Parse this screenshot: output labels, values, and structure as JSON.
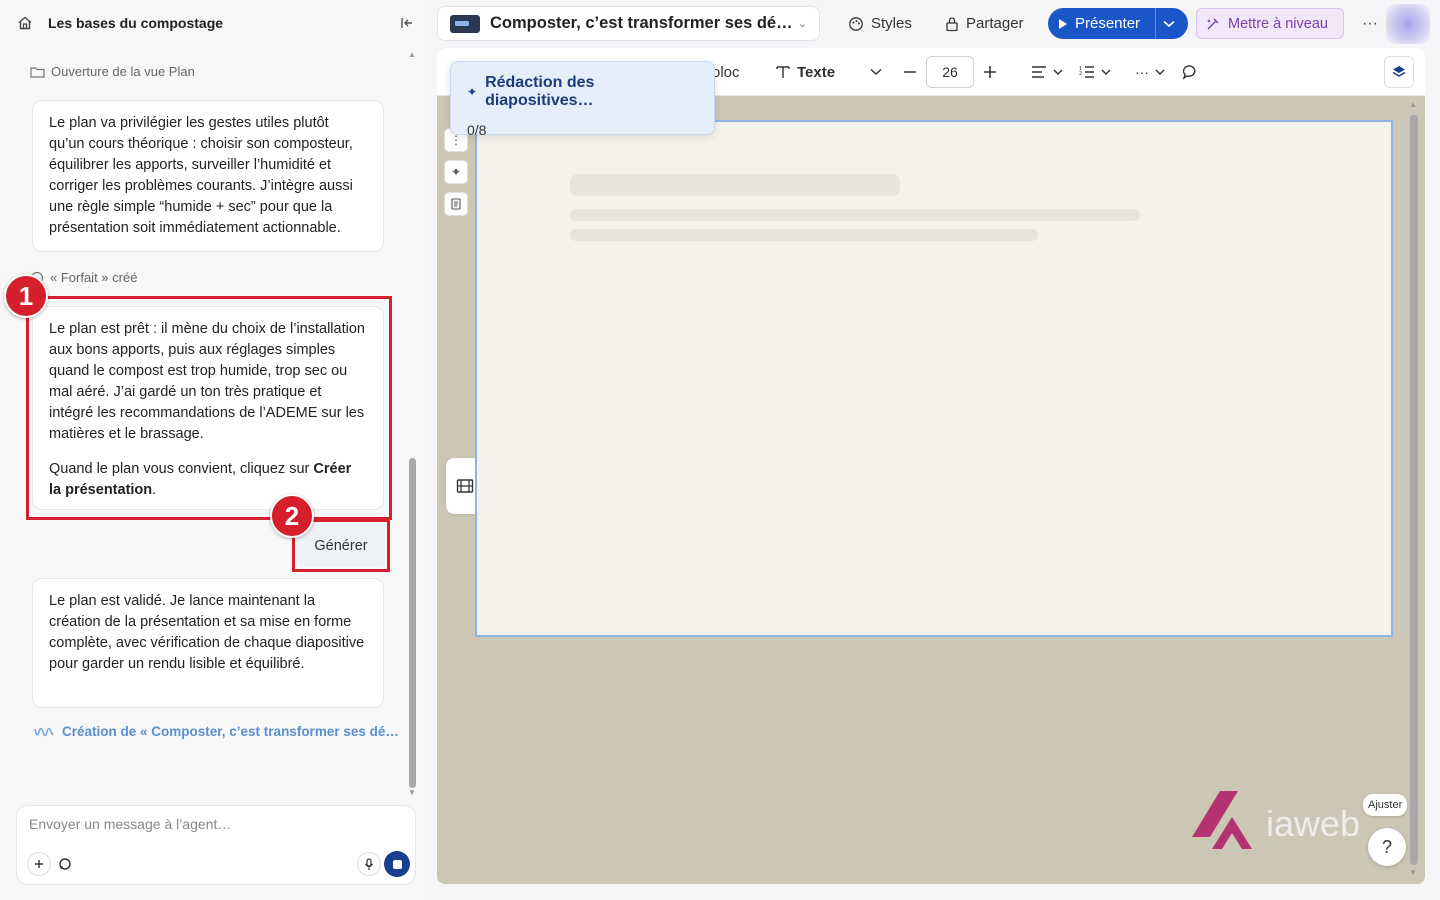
{
  "sidebar": {
    "title": "Les bases du compostage",
    "steps": {
      "plan_view": "Ouverture de la vue Plan",
      "forfait": "« Forfait » créé"
    },
    "messages": {
      "m1": "Le plan va privilégier les gestes utiles plutôt qu’un cours théorique : choisir son composteur, équilibrer les apports, surveiller l’humidité et corriger les problèmes courants. J’intègre aussi une règle simple “humide + sec” pour que la présentation soit immédiatement actionnable.",
      "m2_p1": "Le plan est prêt : il mène du choix de l’installation aux bons apports, puis aux réglages simples quand le compost est trop humide, trop sec ou mal aéré. J’ai gardé un ton très pratique et intégré les recommandations de l’ADEME sur les matières et le brassage.",
      "m2_p2_prefix": "Quand le plan vous convient, cliquez sur ",
      "m2_p2_bold": "Créer la présentation",
      "m2_p2_suffix": ".",
      "m3": "Le plan est validé. Je lance maintenant la création de la présentation et sa mise en forme complète, avec vérification de chaque diapositive pour garder un rendu lisible et équilibré."
    },
    "generate_label": "Générer",
    "creation_status": "Création de « Composter, c’est transformer ses dé…",
    "composer_placeholder": "Envoyer un message à l’agent…"
  },
  "annotations": {
    "badge1": "1",
    "badge2": "2",
    "color": "#d61f2c"
  },
  "topbar": {
    "deck_title": "Composter, c’est transformer ses dé…",
    "styles": "Styles",
    "share": "Partager",
    "present": "Présenter",
    "upgrade": "Mettre à niveau"
  },
  "toolbar": {
    "block_partial": "oloc",
    "text_label": "Texte",
    "font_size": "26"
  },
  "popover": {
    "title": "Rédaction des diapositives…",
    "progress": "0/8"
  },
  "bottom": {
    "adjust": "Ajuster",
    "help": "?",
    "logo_text": "iaweb"
  },
  "colors": {
    "accent": "#1a56c8",
    "editor_bg": "#ccc6b4",
    "slide_bg": "#f5f2ea",
    "upgrade_bg": "#f1e7f8"
  }
}
